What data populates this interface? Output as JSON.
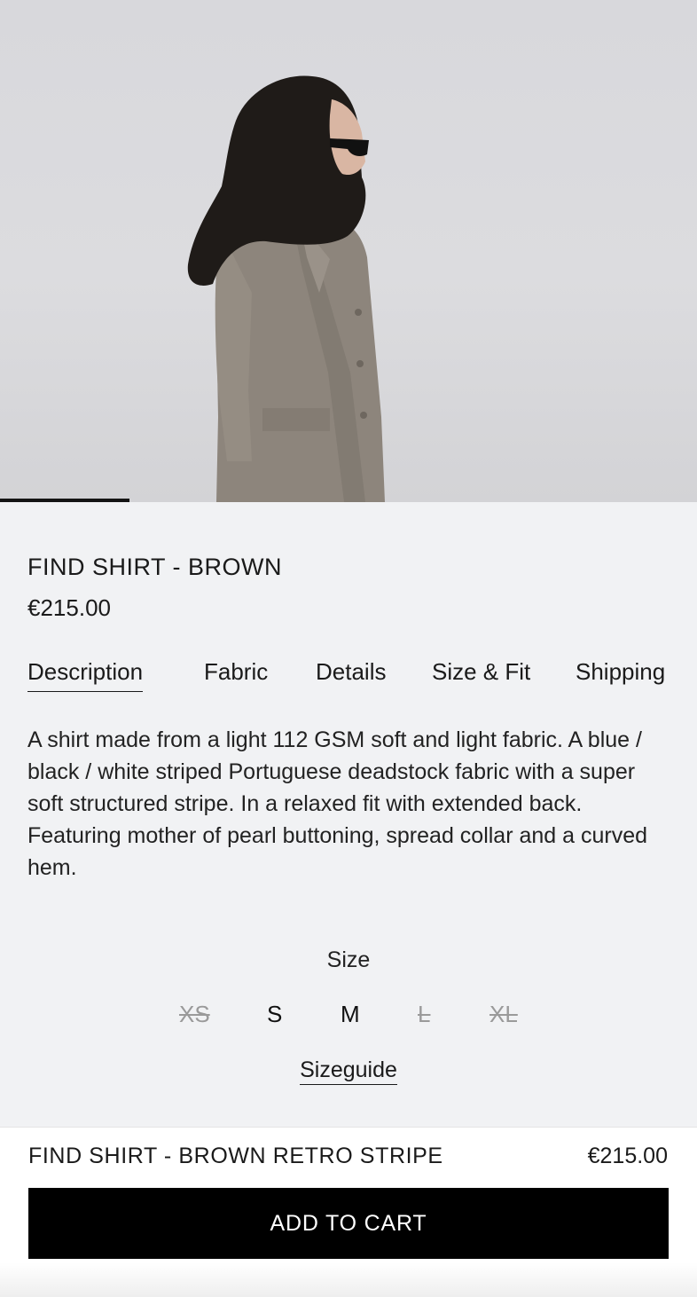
{
  "product": {
    "image_alt": "Model wearing a grey coat and black hood",
    "title": "FIND SHIRT - BROWN",
    "price": "€215.00"
  },
  "tabs": [
    {
      "label": "Description",
      "active": true
    },
    {
      "label": "Fabric",
      "active": false
    },
    {
      "label": "Details",
      "active": false
    },
    {
      "label": "Size & Fit",
      "active": false
    },
    {
      "label": "Shipping",
      "active": false
    }
  ],
  "description": "A shirt made from a light 112 GSM soft and light fabric. A blue / black / white striped Portuguese deadstock fabric with a super soft structured stripe. In a relaxed fit with extended back. Featuring mother of pearl buttoning, spread collar and a curved hem.",
  "size_section": {
    "label": "Size",
    "sizes": [
      {
        "label": "XS",
        "available": false
      },
      {
        "label": "S",
        "available": true
      },
      {
        "label": "M",
        "available": true
      },
      {
        "label": "L",
        "available": false
      },
      {
        "label": "XL",
        "available": false
      }
    ],
    "sizeguide_label": "Sizeguide"
  },
  "sticky_bar": {
    "product_name": "FIND SHIRT - BROWN RETRO STRIPE",
    "price": "€215.00",
    "add_to_cart_label": "ADD TO CART"
  }
}
